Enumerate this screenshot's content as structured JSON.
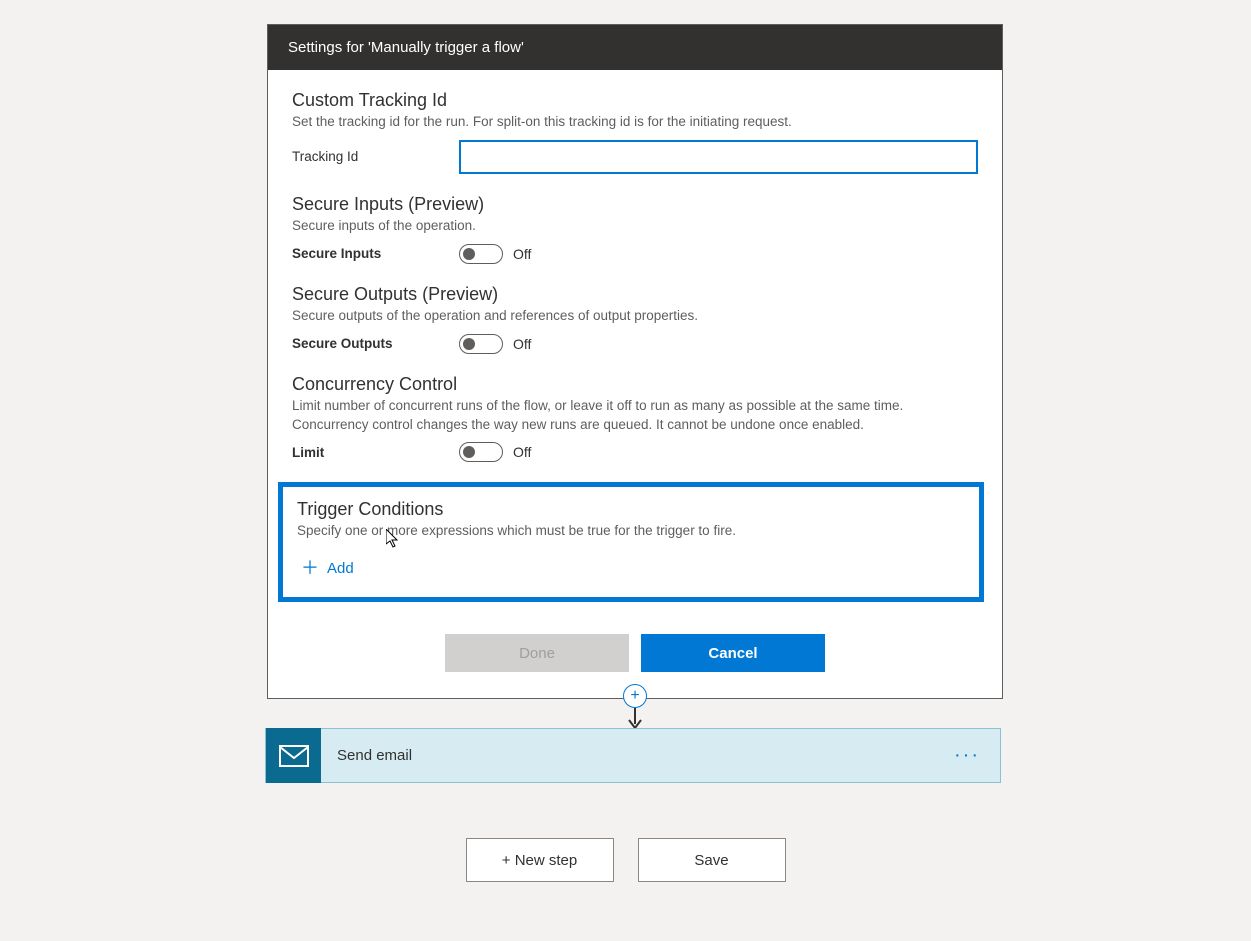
{
  "header": {
    "title": "Settings for 'Manually trigger a flow'"
  },
  "sections": {
    "tracking": {
      "title": "Custom Tracking Id",
      "desc": "Set the tracking id for the run. For split-on this tracking id is for the initiating request.",
      "label": "Tracking Id",
      "value": ""
    },
    "secureInputs": {
      "title": "Secure Inputs (Preview)",
      "desc": "Secure inputs of the operation.",
      "label": "Secure Inputs",
      "state": "Off"
    },
    "secureOutputs": {
      "title": "Secure Outputs (Preview)",
      "desc": "Secure outputs of the operation and references of output properties.",
      "label": "Secure Outputs",
      "state": "Off"
    },
    "concurrency": {
      "title": "Concurrency Control",
      "desc": "Limit number of concurrent runs of the flow, or leave it off to run as many as possible at the same time. Concurrency control changes the way new runs are queued. It cannot be undone once enabled.",
      "label": "Limit",
      "state": "Off"
    },
    "trigger": {
      "title": "Trigger Conditions",
      "desc": "Specify one or more expressions which must be true for the trigger to fire.",
      "addLabel": "Add"
    }
  },
  "footer": {
    "done": "Done",
    "cancel": "Cancel"
  },
  "action": {
    "label": "Send email"
  },
  "bottom": {
    "newStep": "+ New step",
    "save": "Save"
  }
}
